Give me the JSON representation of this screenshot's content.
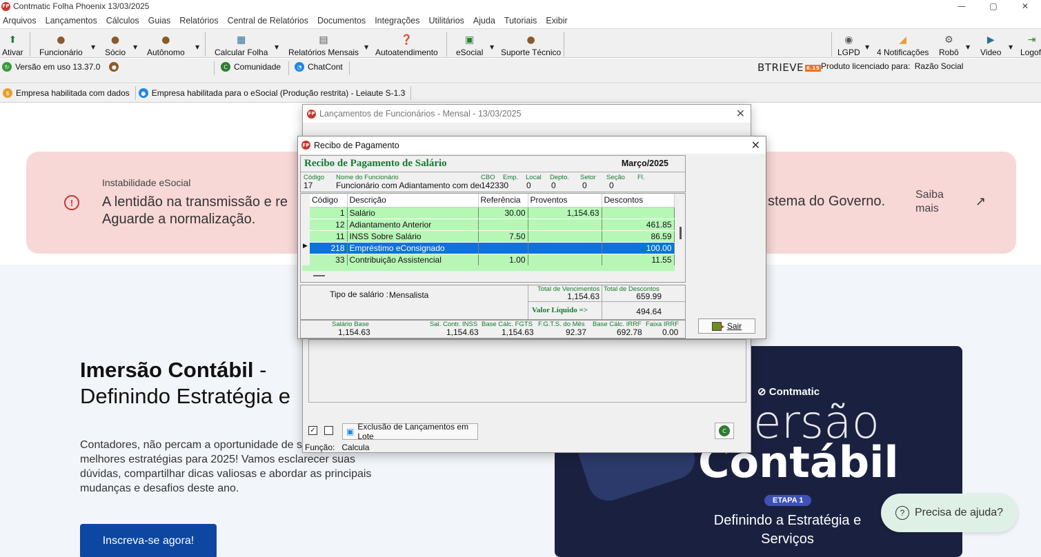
{
  "window": {
    "title": "Contmatic Folha Phoenix 13/03/2025",
    "controls": [
      "—",
      "▢",
      "✕"
    ]
  },
  "menu": [
    "Arquivos",
    "Lançamentos",
    "Cálculos",
    "Guias",
    "Relatórios",
    "Central de Relatórios",
    "Documentos",
    "Integrações",
    "Utilitários",
    "Ajuda",
    "Tutoriais",
    "Exibir"
  ],
  "toolbar": {
    "ativar": "Ativar",
    "funcionario": "Funcionário",
    "socio": "Sócio",
    "autonomo": "Autônomo",
    "calcular_folha": "Calcular Folha",
    "relatorios_mensais": "Relatórios Mensais",
    "autoatendimento": "Autoatendimento",
    "esocial": "eSocial",
    "suporte": "Suporte Técnico",
    "lgpd": "LGPD",
    "notificacoes": "4 Notificações",
    "robo": "Robô",
    "video": "Video",
    "logoff": "Logoff"
  },
  "version_bar": {
    "version": "Versão em uso 13.37.0",
    "comunidade": "Comunidade",
    "chatcont": "ChatCont",
    "btrieve": "BTRIEVE",
    "btrieve_badge": "6.15",
    "license_label": "Produto licenciado para:",
    "license_value": "Razão Social"
  },
  "status_bar": {
    "empresa_dados": "Empresa habilitada com dados",
    "empresa_esocial": "Empresa habilitada para o eSocial (Produção restrita) - Leiaute S-1.3"
  },
  "web": {
    "alert_label": "Instabilidade eSocial",
    "alert_text": "A lentidão na transmissão e re Aguarde a normalização.",
    "alert_text_right": "stema do Governo.",
    "saiba_mais": "Saiba mais",
    "arrow": "↗",
    "title_bold": "Imersão Contábil",
    "title_rest": " -",
    "title_line2": "Definindo Estratégia e",
    "description": "Contadores, não percam a oportunidade de sobre as melhores estratégias para 2025! Vamos esclarecer suas dúvidas, compartilhar dicas valiosas e abordar as principais mudanças e desafios deste ano.",
    "cta": "Inscreva-se agora!",
    "banner_logo": "Contmatic",
    "banner_big1": "ersão",
    "banner_big2": "Contábil",
    "banner_etapa": "ETAPA 1",
    "banner_sub": "Definindo a Estratégia e Serviços",
    "help": "Precisa de ajuda?"
  },
  "lancamentos_dialog": {
    "title": "Lançamentos de Funcionários - Mensal -  13/03/2025",
    "exclusao_button": "Exclusão de Lançamentos em Lote",
    "funcao_label": "Função:",
    "funcao_value": "Calcula"
  },
  "recibo_dialog": {
    "title": "Recibo de Pagamento",
    "heading": "Recibo de Pagamento de Salário",
    "month": "Março/2025",
    "header_labels": {
      "codigo": "Código",
      "nome": "Nome do Funcionário",
      "cbo": "CBO",
      "emp": "Emp.",
      "local": "Local",
      "depto": "Depto.",
      "setor": "Setor",
      "secao": "Seção",
      "fl": "Fl."
    },
    "header_values": {
      "codigo": "17",
      "nome": "Funcionário com Adiantamento com deduçã",
      "cbo": "142330",
      "local": "0",
      "depto": "0",
      "setor": "0",
      "secao": "0"
    },
    "columns": [
      "Código",
      "Descrição",
      "Referência",
      "Proventos",
      "Descontos"
    ],
    "rows": [
      {
        "codigo": "1",
        "descricao": "Salário",
        "referencia": "30.00",
        "proventos": "1,154.63",
        "descontos": ""
      },
      {
        "codigo": "12",
        "descricao": "Adiantamento Anterior",
        "referencia": "",
        "proventos": "",
        "descontos": "461.85"
      },
      {
        "codigo": "11",
        "descricao": "INSS Sobre Salário",
        "referencia": "7.50",
        "proventos": "",
        "descontos": "86.59"
      },
      {
        "codigo": "218",
        "descricao": "Empréstimo eConsignado",
        "referencia": "",
        "proventos": "",
        "descontos": "100.00"
      },
      {
        "codigo": "33",
        "descricao": "Contribuição Assistencial",
        "referencia": "1.00",
        "proventos": "",
        "descontos": "11.55"
      }
    ],
    "tipo_salario_label": "Tipo de salário :",
    "tipo_salario_value": "Mensalista",
    "total_vencimentos_label": "Total de Vencimentos",
    "total_vencimentos": "1,154.63",
    "total_descontos_label": "Total de Descontos",
    "total_descontos": "659.99",
    "valor_liquido_label": "Valor Líquido  =>",
    "valor_liquido": "494.64",
    "footer_labels": {
      "salario_base": "Salário Base",
      "sal_contr_inss": "Sal. Contr. INSS",
      "base_fgts": "Base Cálc. FGTS",
      "fgts_mes": "F.G.T.S. do Mês",
      "base_irrf": "Base Cálc. IRRF",
      "faixa_irrf": "Faixa IRRF"
    },
    "footer_values": {
      "salario_base": "1,154.63",
      "sal_contr_inss": "1,154.63",
      "base_fgts": "1,154.63",
      "fgts_mes": "92.37",
      "base_irrf": "692.78",
      "faixa_irrf": "0.00"
    },
    "sair": "Sair"
  }
}
